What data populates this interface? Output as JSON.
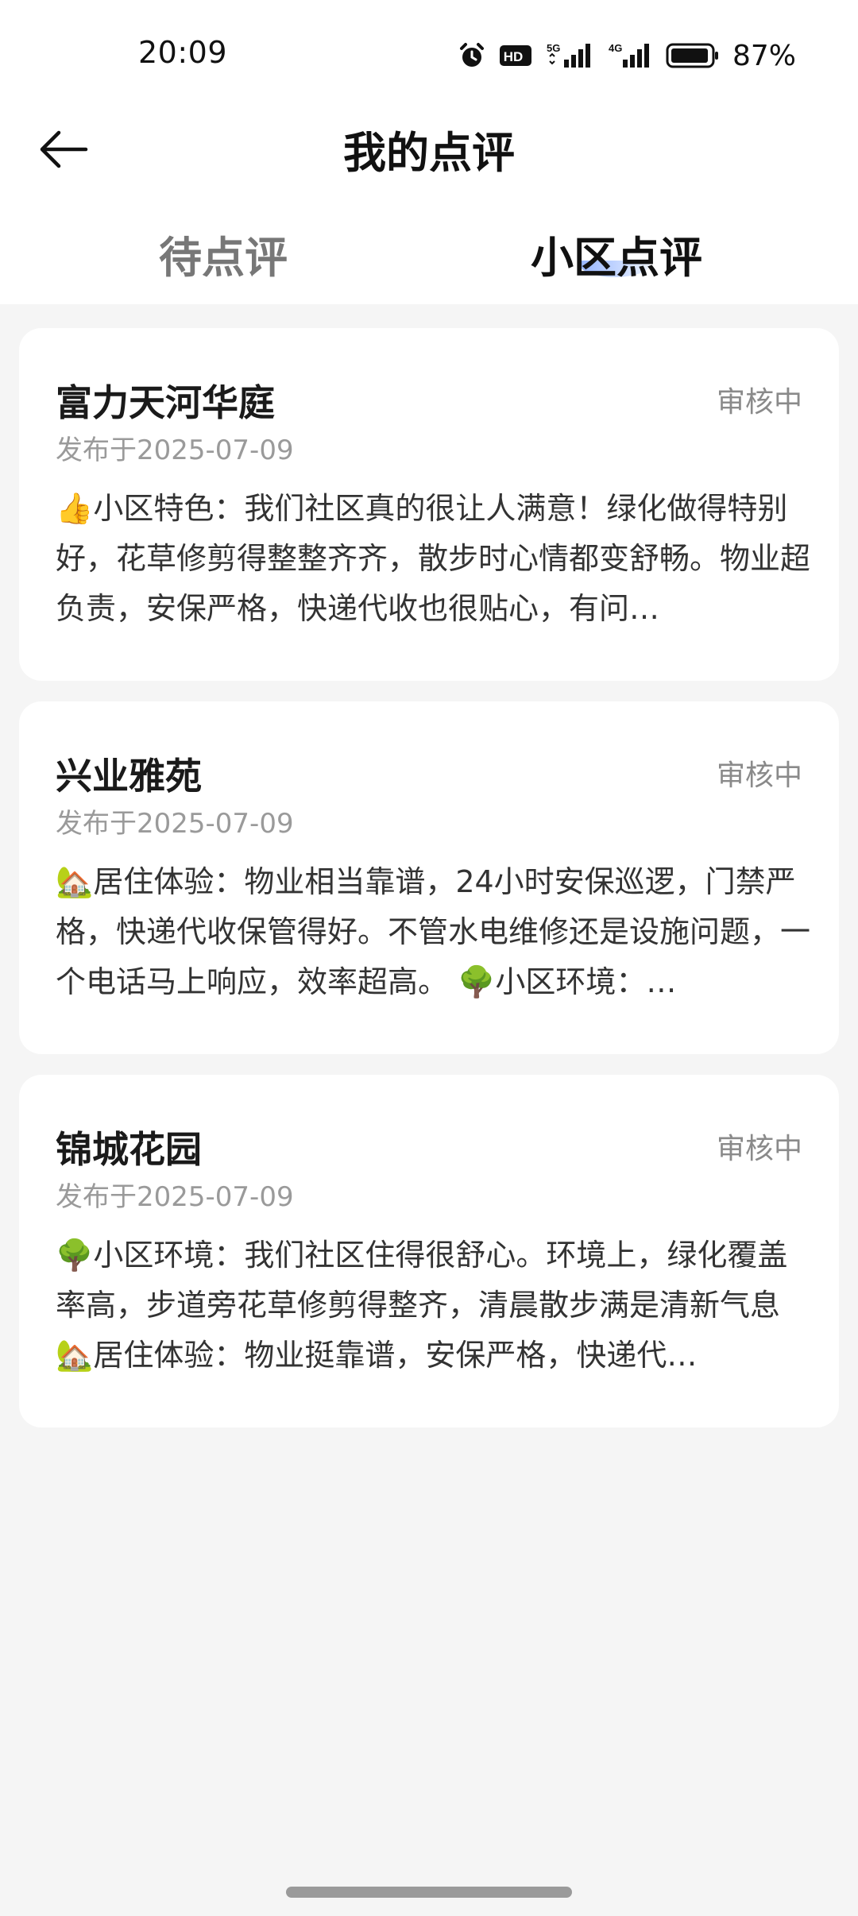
{
  "status_bar": {
    "time": "20:09",
    "hd_label": "HD",
    "network_5g": "5G",
    "network_4g": "4G",
    "battery": "87%"
  },
  "header": {
    "title": "我的点评"
  },
  "tabs": [
    {
      "label": "待点评"
    },
    {
      "label": "小区点评"
    }
  ],
  "reviews": [
    {
      "community": "富力天河华庭",
      "status": "审核中",
      "date": "发布于2025-07-09",
      "content": "👍小区特色：我们社区真的很让人满意！绿化做得特别好，花草修剪得整整齐齐，散步时心情都变舒畅。物业超负责，安保严格，快递代收也很贴心，有问…"
    },
    {
      "community": "兴业雅苑",
      "status": "审核中",
      "date": "发布于2025-07-09",
      "content": "🏡居住体验：物业相当靠谱，24小时安保巡逻，门禁严格，快递代收保管得好。不管水电维修还是设施问题，一个电话马上响应，效率超高。 🌳小区环境：…"
    },
    {
      "community": "锦城花园",
      "status": "审核中",
      "date": "发布于2025-07-09",
      "content": "🌳小区环境：我们社区住得很舒心。环境上，绿化覆盖率高，步道旁花草修剪得整齐，清晨散步满是清新气息 🏡居住体验：物业挺靠谱，安保严格，快递代…"
    }
  ]
}
